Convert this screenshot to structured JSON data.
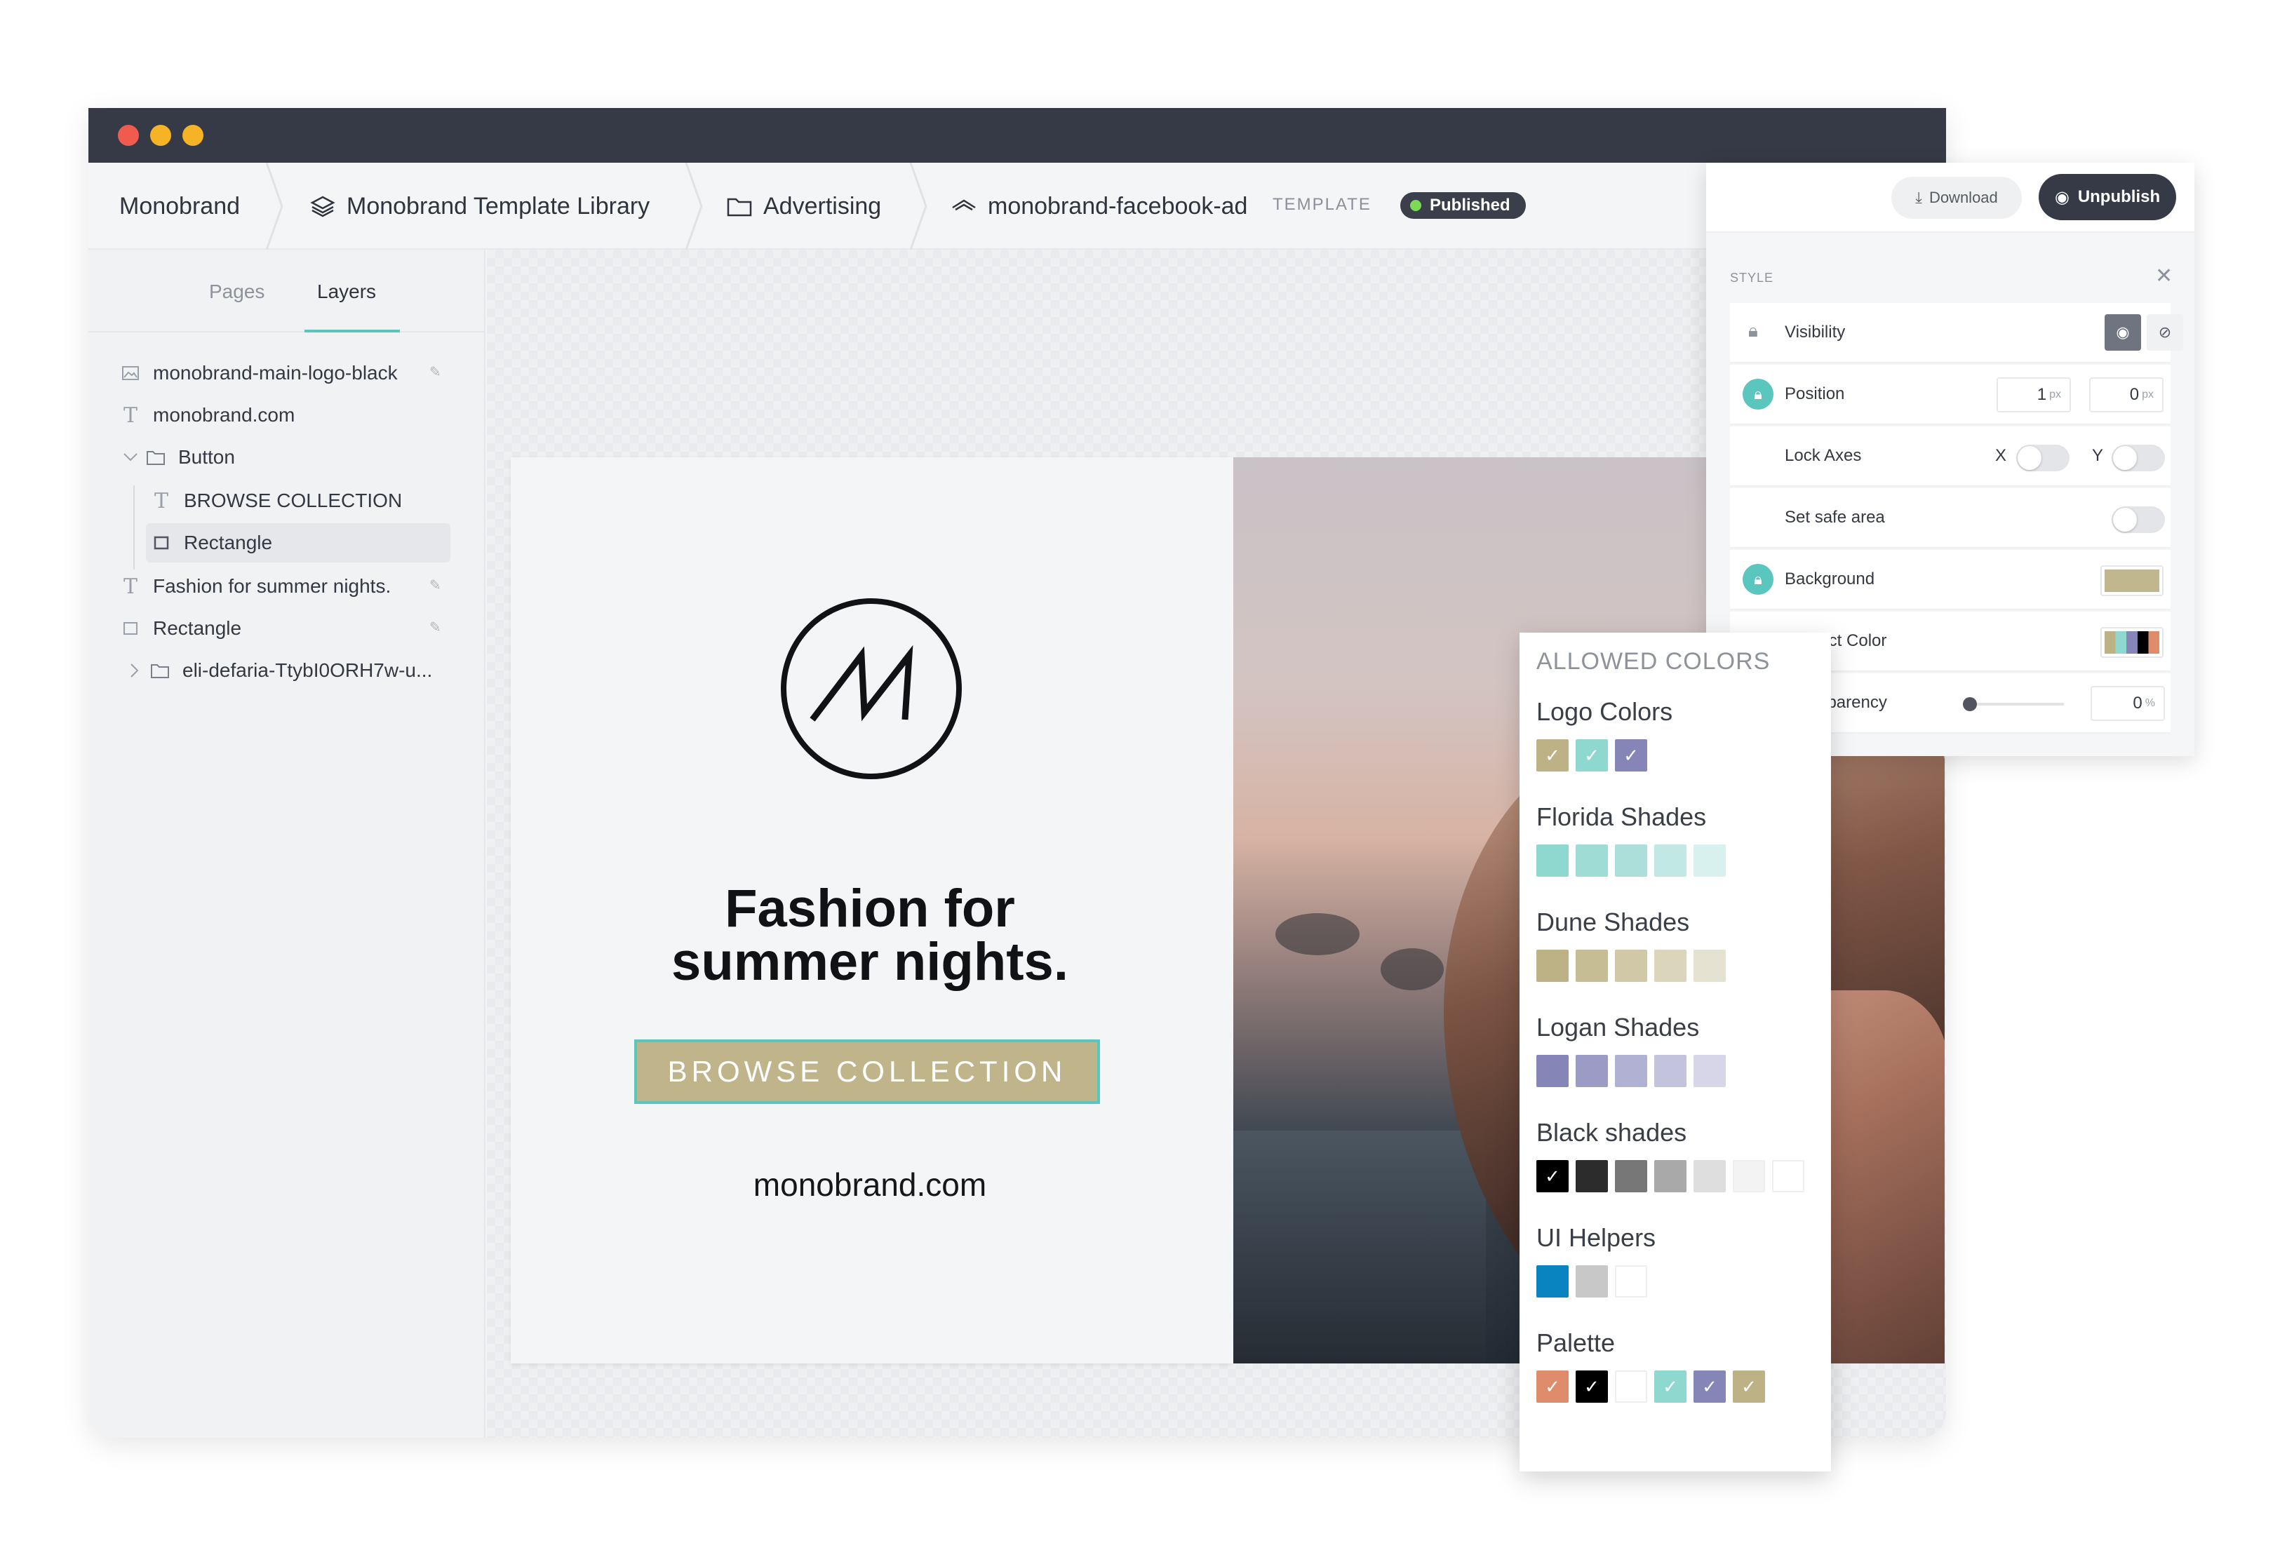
{
  "breadcrumb": {
    "root": "Monobrand",
    "library": "Monobrand Template Library",
    "folder": "Advertising",
    "file": "monobrand-facebook-ad",
    "file_tag": "TEMPLATE",
    "status": "Published"
  },
  "left_panel": {
    "tabs": [
      "Pages",
      "Layers"
    ],
    "active_tab": "Layers",
    "layers": [
      {
        "label": "monobrand-main-logo-black",
        "icon": "image-icon"
      },
      {
        "label": "monobrand.com",
        "icon": "text-icon"
      },
      {
        "label": "Button",
        "icon": "folder-icon",
        "expanded": true
      },
      {
        "label": "BROWSE COLLECTION",
        "icon": "text-icon"
      },
      {
        "label": "Rectangle",
        "icon": "rectangle-icon",
        "selected": true
      },
      {
        "label": "Fashion for summer nights.",
        "icon": "text-icon"
      },
      {
        "label": "Rectangle",
        "icon": "rectangle-icon"
      },
      {
        "label": "eli-defaria-TtybI0ORH7w-u...",
        "icon": "folder-icon",
        "expanded": false
      }
    ]
  },
  "ad": {
    "headline_line1": "Fashion for",
    "headline_line2": "summer nights.",
    "cta": "BROWSE COLLECTION",
    "url": "monobrand.com"
  },
  "style_panel": {
    "download": "Download",
    "unpublish": "Unpublish",
    "section": "STYLE",
    "visibility": "Visibility",
    "position": "Position",
    "position_x": "1",
    "position_y": "0",
    "unit_px": "px",
    "lock_axes": "Lock Axes",
    "axis_x": "X",
    "axis_y": "Y",
    "safe_area": "Set safe area",
    "background": "Background",
    "background_color": "#c0b78e",
    "restrict_color": "Restrict Color",
    "transparency": "Transparency",
    "transparency_value": "0",
    "unit_pct": "%"
  },
  "allowed_colors": {
    "title": "ALLOWED COLORS",
    "groups": [
      {
        "name": "Logo Colors",
        "colors": [
          "#bdb285",
          "#8fd8d0",
          "#8585b8"
        ],
        "checked": [
          0,
          1,
          2
        ]
      },
      {
        "name": "Florida Shades",
        "colors": [
          "#8fd8d0",
          "#9edcd5",
          "#acdfd9",
          "#c2e8e3",
          "#d9f1ee"
        ],
        "checked": []
      },
      {
        "name": "Dune Shades",
        "colors": [
          "#bdb285",
          "#c7bd94",
          "#d0c8a6",
          "#dbd5bc",
          "#e6e2d1"
        ],
        "checked": []
      },
      {
        "name": "Logan Shades",
        "colors": [
          "#8585b8",
          "#9b9bc6",
          "#b1b1d3",
          "#c3c3dd",
          "#d6d6e8"
        ],
        "checked": []
      },
      {
        "name": "Black shades",
        "colors": [
          "#000000",
          "#2c2c2c",
          "#777777",
          "#a9a9a9",
          "#dedede",
          "#f3f3f3",
          "#ffffff"
        ],
        "checked": [
          0
        ]
      },
      {
        "name": "UI Helpers",
        "colors": [
          "#0a84c0",
          "#c8c8c8",
          "#ffffff"
        ],
        "checked": []
      },
      {
        "name": "Palette",
        "colors": [
          "#de8c6c",
          "#000000",
          "#ffffff",
          "#8fd8d0",
          "#8585b8",
          "#bdb285"
        ],
        "checked": [
          0,
          1,
          3,
          4,
          5
        ]
      }
    ]
  }
}
